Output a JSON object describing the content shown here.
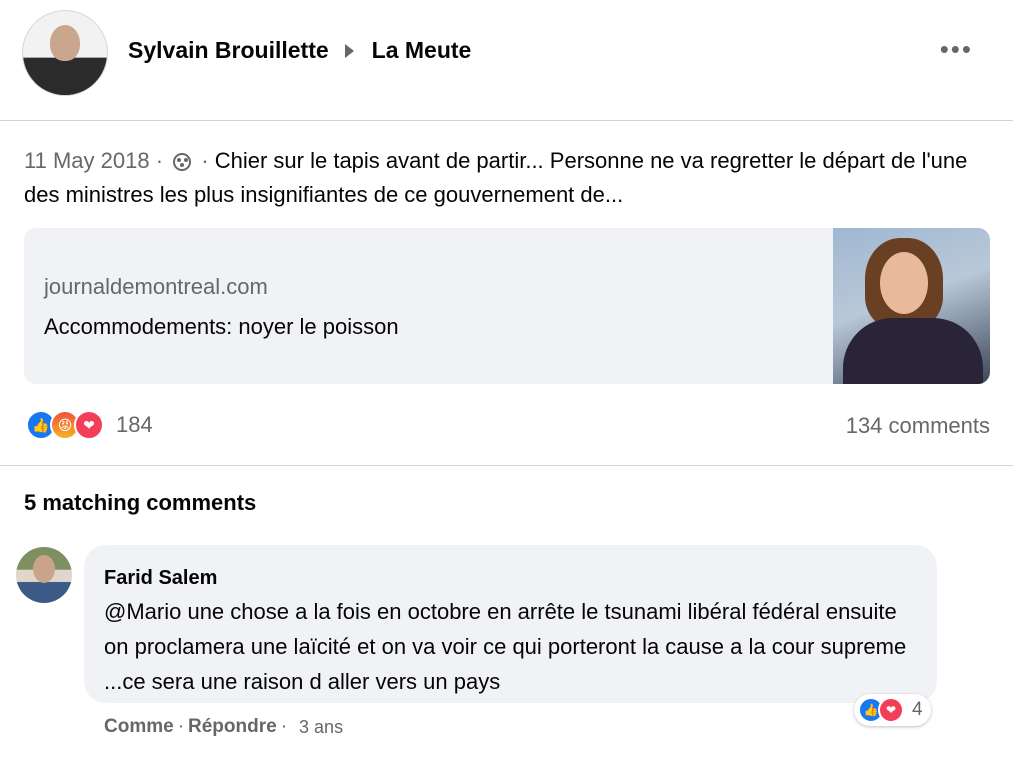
{
  "post": {
    "author": "Sylvain Brouillette",
    "group": "La Meute",
    "more_label": "•••",
    "date": "11 May 2018",
    "separator": "·",
    "text": "Chier sur le tapis avant de partir... Personne ne va regretter le départ de l'une des ministres les plus insignifiantes de ce gouvernement de..."
  },
  "link": {
    "domain": "journaldemontreal.com",
    "title": "Accommodements: noyer le poisson"
  },
  "stats": {
    "reaction_count": "184",
    "comments": "134 comments",
    "reaction_icons": [
      "like-icon",
      "angry-icon",
      "love-icon"
    ]
  },
  "matching": {
    "title": "5 matching comments"
  },
  "comment": {
    "author": "Farid Salem",
    "text": "@Mario une chose a la fois en octobre en arrête le tsunami libéral fédéral ensuite on proclamera une laïcité et on va voir ce qui porteront la cause a la cour supreme ...ce sera une raison d aller vers un pays",
    "reaction_count": "4",
    "like_label": "Comme",
    "reply_label": "Répondre",
    "dot": "·",
    "time": "3 ans"
  },
  "colors": {
    "like": "#1877f2",
    "love": "#f33e58",
    "secondary_text": "#65676b",
    "bubble_bg": "#f0f2f5"
  }
}
